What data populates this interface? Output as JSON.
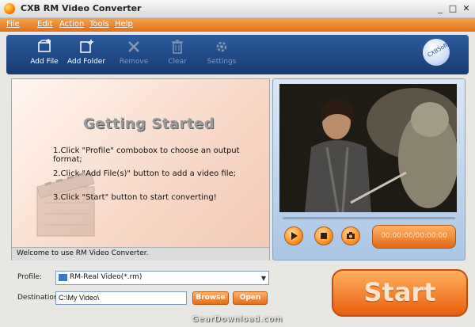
{
  "window": {
    "title": "CXB RM Video Converter",
    "min_glyph": "_",
    "max_glyph": "□",
    "close_glyph": "✕"
  },
  "menu": [
    "File",
    "Edit",
    "Action",
    "Tools",
    "Help"
  ],
  "toolbar": {
    "items": [
      {
        "label": "Add File",
        "icon": "add-file-icon",
        "enabled": true
      },
      {
        "label": "Add  Folder",
        "icon": "add-folder-icon",
        "enabled": true
      },
      {
        "label": "Remove",
        "icon": "remove-icon",
        "enabled": false
      },
      {
        "label": "Clear",
        "icon": "trash-icon",
        "enabled": false
      },
      {
        "label": "Settings",
        "icon": "gear-icon",
        "enabled": false
      }
    ],
    "logo_text": "CXBSoft"
  },
  "getting_started": {
    "title": "Getting  Started",
    "steps": [
      "1.Click \"Profile\" combobox to choose an output format;",
      "2.Click \"Add File(s)\" button to add a video file;",
      "3.Click \"Start\" button to start converting!"
    ],
    "status": "Welcome to use RM Video Converter."
  },
  "player": {
    "time": "00:00:00/00:00:00",
    "play_icon": "play-icon",
    "stop_icon": "stop-icon",
    "snapshot_icon": "camera-icon"
  },
  "form": {
    "profile_label": "Profile:",
    "profile_value": "RM-Real Video(*.rm)",
    "destination_label": "Destination:",
    "destination_value": "C:\\My Video\\",
    "browse_label": "Browse",
    "open_label": "Open",
    "start_label": "Start"
  },
  "watermark": "GearDownload.com",
  "colors": {
    "accent": "#e8731e",
    "toolbar": "#1f477f",
    "start": "#ef7a24"
  }
}
